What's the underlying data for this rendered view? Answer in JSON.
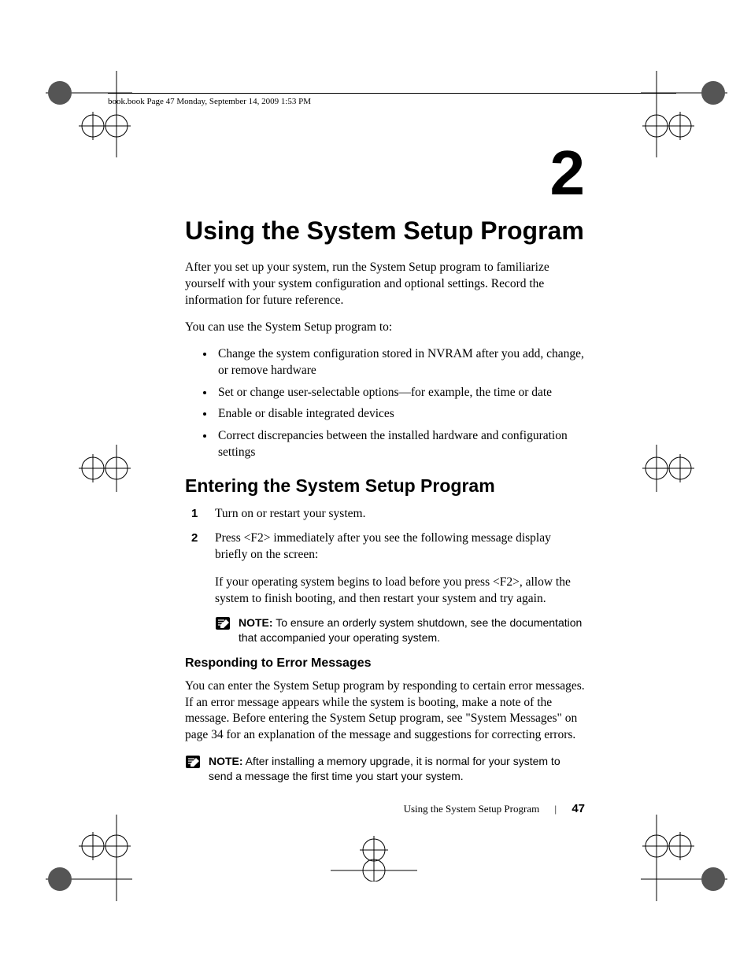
{
  "header": {
    "runner": "book.book  Page 47  Monday, September 14, 2009  1:53 PM"
  },
  "chapter": {
    "number": "2",
    "title": "Using the System Setup Program"
  },
  "intro": {
    "p1": "After you set up your system, run the System Setup program to familiarize yourself with your system configuration and optional settings. Record the information for future reference.",
    "p2": "You can use the System Setup program to:"
  },
  "bullets": [
    "Change the system configuration stored in NVRAM after you add, change, or remove hardware",
    "Set or change user-selectable options—for example, the time or date",
    "Enable or disable integrated devices",
    "Correct discrepancies between the installed hardware and configuration settings"
  ],
  "section1": {
    "heading": "Entering the System Setup Program",
    "steps": [
      "Turn on or restart your system.",
      "Press <F2> immediately after you see the following message display briefly on the screen:"
    ],
    "step2_cont": "If your operating system begins to load before you press <F2>, allow the system to finish booting, and then restart your system and try again.",
    "note1_label": "NOTE:",
    "note1_text": " To ensure an orderly system shutdown, see the documentation that accompanied your operating system."
  },
  "section2": {
    "heading": "Responding to Error Messages",
    "p1": "You can enter the System Setup program by responding to certain error messages. If an error message appears while the system is booting, make a note of the message. Before entering the System Setup program, see \"System Messages\" on page 34 for an explanation of the message and suggestions for correcting errors.",
    "note2_label": "NOTE:",
    "note2_text": " After installing a memory upgrade, it is normal for your system to send a message the first time you start your system."
  },
  "footer": {
    "title": "Using the System Setup Program",
    "page": "47"
  }
}
